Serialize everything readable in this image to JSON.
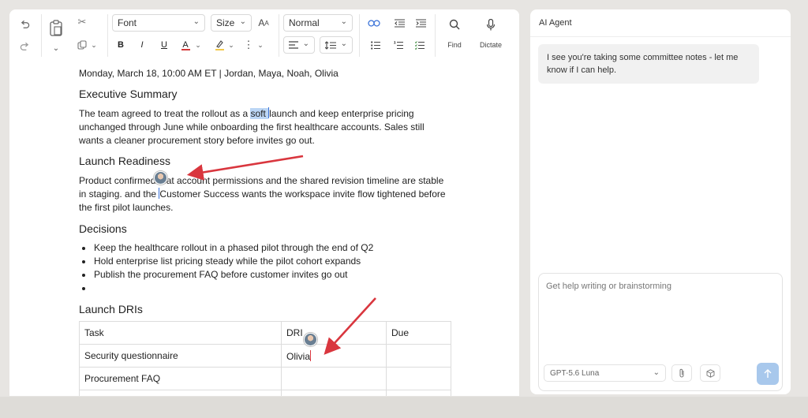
{
  "toolbar": {
    "font": "Font",
    "size": "Size",
    "style": "Normal",
    "find_label": "Find",
    "dictate_label": "Dictate",
    "icons": [
      "undo-icon",
      "redo-icon",
      "paste-icon",
      "cut-icon",
      "copy-icon",
      "text-effects-icon",
      "bold-icon",
      "italic-icon",
      "underline-icon",
      "font-color-icon",
      "highlight-icon",
      "more-icon",
      "align-icon",
      "line-spacing-icon",
      "link-icon",
      "indent-decrease-icon",
      "indent-increase-icon",
      "bulleted-list-icon",
      "numbered-list-icon",
      "checklist-icon",
      "find-icon",
      "microphone-icon"
    ]
  },
  "doc": {
    "meta_line": "Monday, March 18, 10:00 AM ET | Jordan, Maya, Noah, Olivia",
    "exec_heading": "Executive Summary",
    "exec_p1_a": "The team agreed to treat the rollout as a ",
    "exec_p1_hl": "soft ",
    "exec_p1_b": "launch and keep enterprise pricing",
    "exec_p2": "unchanged through June while onboarding the first healthcare accounts. Sales still",
    "exec_p3": "wants a cleaner procurement story before invites go out.",
    "launch_heading": "Launch Readiness",
    "launch_p1": "Product confirmed that account permissions and the shared revision timeline are stable",
    "launch_p2_a": "in staging. and the ",
    "launch_p2_b": "Customer Success wants the workspace invite flow tightened before",
    "launch_p3": "the first pilot launches.",
    "decisions_heading": "Decisions",
    "decisions": [
      "Keep the healthcare rollout in a phased pilot through the end of Q2",
      "Hold enterprise list pricing steady while the pilot cohort expands",
      "Publish the procurement FAQ before customer invites go out",
      ""
    ],
    "dri_heading": "Launch DRIs",
    "table": {
      "headers": [
        "Task",
        "DRI",
        "Due"
      ],
      "rows": [
        [
          "Security questionnaire",
          "Olivia",
          ""
        ],
        [
          "Procurement FAQ",
          "",
          ""
        ],
        [
          "",
          "",
          ""
        ]
      ]
    }
  },
  "agent": {
    "title": "AI Agent",
    "message": "I see you're taking some committee notes - let me know if I can help.",
    "placeholder": "Get help writing or brainstorming",
    "model": "GPT-5.6 Luna"
  },
  "colors": {
    "arrow": "#d9363e",
    "selection": "#bcd6f5",
    "send_button": "#a8c8ec"
  }
}
